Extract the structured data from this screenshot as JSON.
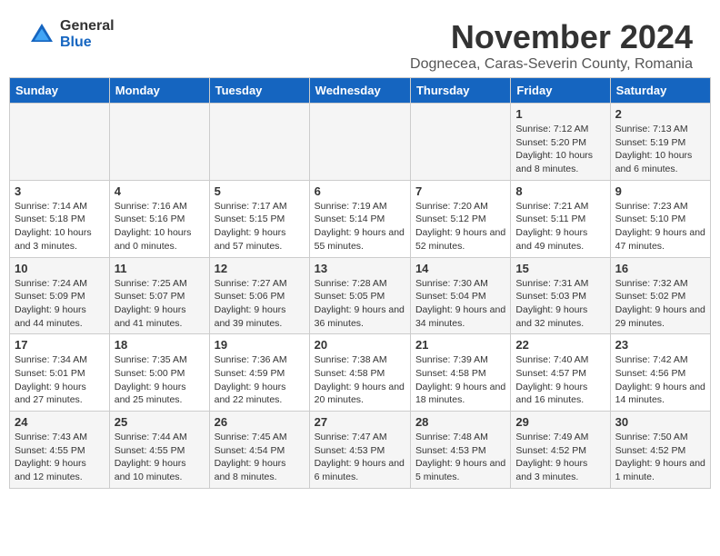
{
  "header": {
    "logo": {
      "general": "General",
      "blue": "Blue"
    },
    "title": "November 2024",
    "location": "Dognecea, Caras-Severin County, Romania"
  },
  "weekdays": [
    "Sunday",
    "Monday",
    "Tuesday",
    "Wednesday",
    "Thursday",
    "Friday",
    "Saturday"
  ],
  "weeks": [
    [
      {
        "day": "",
        "info": ""
      },
      {
        "day": "",
        "info": ""
      },
      {
        "day": "",
        "info": ""
      },
      {
        "day": "",
        "info": ""
      },
      {
        "day": "",
        "info": ""
      },
      {
        "day": "1",
        "info": "Sunrise: 7:12 AM\nSunset: 5:20 PM\nDaylight: 10 hours and 8 minutes."
      },
      {
        "day": "2",
        "info": "Sunrise: 7:13 AM\nSunset: 5:19 PM\nDaylight: 10 hours and 6 minutes."
      }
    ],
    [
      {
        "day": "3",
        "info": "Sunrise: 7:14 AM\nSunset: 5:18 PM\nDaylight: 10 hours and 3 minutes."
      },
      {
        "day": "4",
        "info": "Sunrise: 7:16 AM\nSunset: 5:16 PM\nDaylight: 10 hours and 0 minutes."
      },
      {
        "day": "5",
        "info": "Sunrise: 7:17 AM\nSunset: 5:15 PM\nDaylight: 9 hours and 57 minutes."
      },
      {
        "day": "6",
        "info": "Sunrise: 7:19 AM\nSunset: 5:14 PM\nDaylight: 9 hours and 55 minutes."
      },
      {
        "day": "7",
        "info": "Sunrise: 7:20 AM\nSunset: 5:12 PM\nDaylight: 9 hours and 52 minutes."
      },
      {
        "day": "8",
        "info": "Sunrise: 7:21 AM\nSunset: 5:11 PM\nDaylight: 9 hours and 49 minutes."
      },
      {
        "day": "9",
        "info": "Sunrise: 7:23 AM\nSunset: 5:10 PM\nDaylight: 9 hours and 47 minutes."
      }
    ],
    [
      {
        "day": "10",
        "info": "Sunrise: 7:24 AM\nSunset: 5:09 PM\nDaylight: 9 hours and 44 minutes."
      },
      {
        "day": "11",
        "info": "Sunrise: 7:25 AM\nSunset: 5:07 PM\nDaylight: 9 hours and 41 minutes."
      },
      {
        "day": "12",
        "info": "Sunrise: 7:27 AM\nSunset: 5:06 PM\nDaylight: 9 hours and 39 minutes."
      },
      {
        "day": "13",
        "info": "Sunrise: 7:28 AM\nSunset: 5:05 PM\nDaylight: 9 hours and 36 minutes."
      },
      {
        "day": "14",
        "info": "Sunrise: 7:30 AM\nSunset: 5:04 PM\nDaylight: 9 hours and 34 minutes."
      },
      {
        "day": "15",
        "info": "Sunrise: 7:31 AM\nSunset: 5:03 PM\nDaylight: 9 hours and 32 minutes."
      },
      {
        "day": "16",
        "info": "Sunrise: 7:32 AM\nSunset: 5:02 PM\nDaylight: 9 hours and 29 minutes."
      }
    ],
    [
      {
        "day": "17",
        "info": "Sunrise: 7:34 AM\nSunset: 5:01 PM\nDaylight: 9 hours and 27 minutes."
      },
      {
        "day": "18",
        "info": "Sunrise: 7:35 AM\nSunset: 5:00 PM\nDaylight: 9 hours and 25 minutes."
      },
      {
        "day": "19",
        "info": "Sunrise: 7:36 AM\nSunset: 4:59 PM\nDaylight: 9 hours and 22 minutes."
      },
      {
        "day": "20",
        "info": "Sunrise: 7:38 AM\nSunset: 4:58 PM\nDaylight: 9 hours and 20 minutes."
      },
      {
        "day": "21",
        "info": "Sunrise: 7:39 AM\nSunset: 4:58 PM\nDaylight: 9 hours and 18 minutes."
      },
      {
        "day": "22",
        "info": "Sunrise: 7:40 AM\nSunset: 4:57 PM\nDaylight: 9 hours and 16 minutes."
      },
      {
        "day": "23",
        "info": "Sunrise: 7:42 AM\nSunset: 4:56 PM\nDaylight: 9 hours and 14 minutes."
      }
    ],
    [
      {
        "day": "24",
        "info": "Sunrise: 7:43 AM\nSunset: 4:55 PM\nDaylight: 9 hours and 12 minutes."
      },
      {
        "day": "25",
        "info": "Sunrise: 7:44 AM\nSunset: 4:55 PM\nDaylight: 9 hours and 10 minutes."
      },
      {
        "day": "26",
        "info": "Sunrise: 7:45 AM\nSunset: 4:54 PM\nDaylight: 9 hours and 8 minutes."
      },
      {
        "day": "27",
        "info": "Sunrise: 7:47 AM\nSunset: 4:53 PM\nDaylight: 9 hours and 6 minutes."
      },
      {
        "day": "28",
        "info": "Sunrise: 7:48 AM\nSunset: 4:53 PM\nDaylight: 9 hours and 5 minutes."
      },
      {
        "day": "29",
        "info": "Sunrise: 7:49 AM\nSunset: 4:52 PM\nDaylight: 9 hours and 3 minutes."
      },
      {
        "day": "30",
        "info": "Sunrise: 7:50 AM\nSunset: 4:52 PM\nDaylight: 9 hours and 1 minute."
      }
    ]
  ]
}
